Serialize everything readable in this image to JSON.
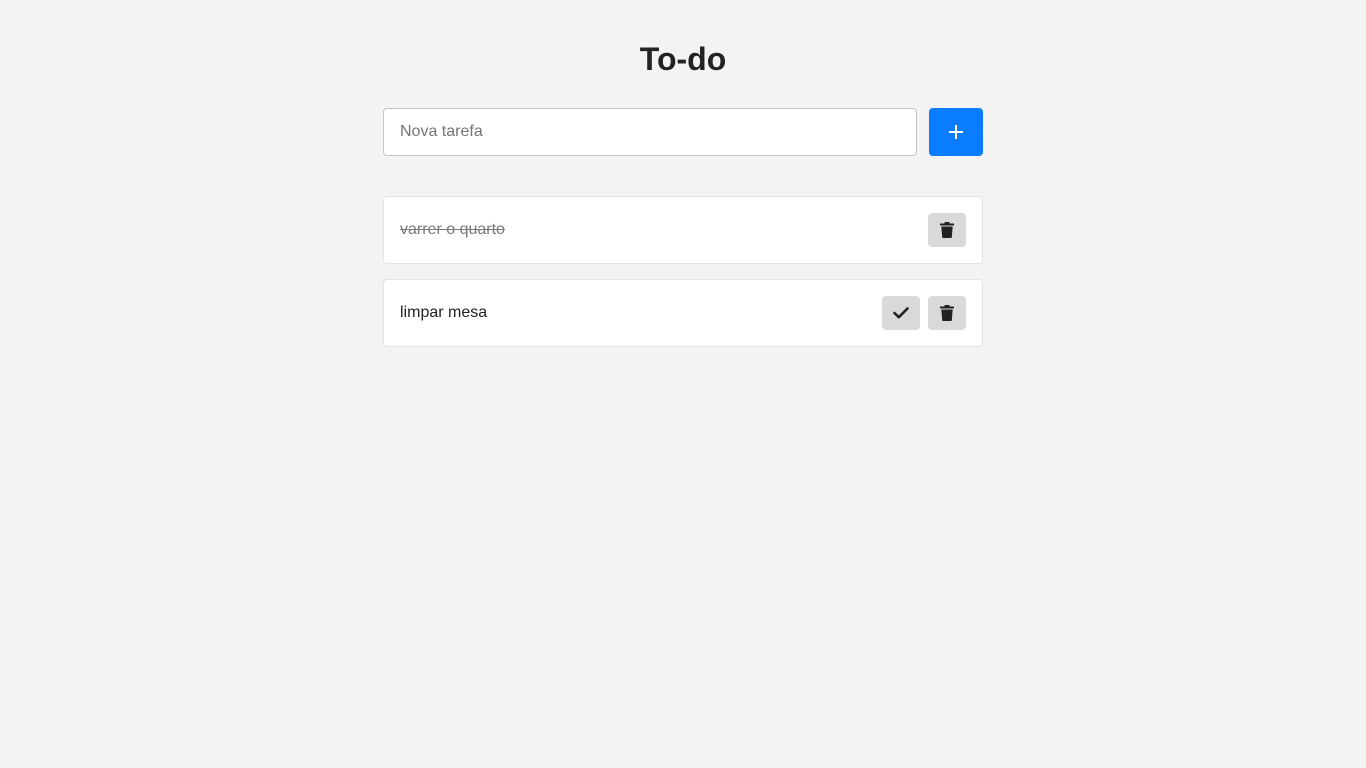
{
  "header": {
    "title": "To-do"
  },
  "form": {
    "input_placeholder": "Nova tarefa",
    "input_value": "",
    "add_icon": "plus-icon"
  },
  "tasks": [
    {
      "text": "varrer o quarto",
      "completed": true,
      "actions": [
        "trash-icon"
      ]
    },
    {
      "text": "limpar mesa",
      "completed": false,
      "actions": [
        "check-icon",
        "trash-icon"
      ]
    }
  ],
  "colors": {
    "background": "#f3f3f3",
    "accent": "#0a7cff",
    "action_button": "#d9d9d9",
    "completed_text": "#7a7a7a"
  }
}
